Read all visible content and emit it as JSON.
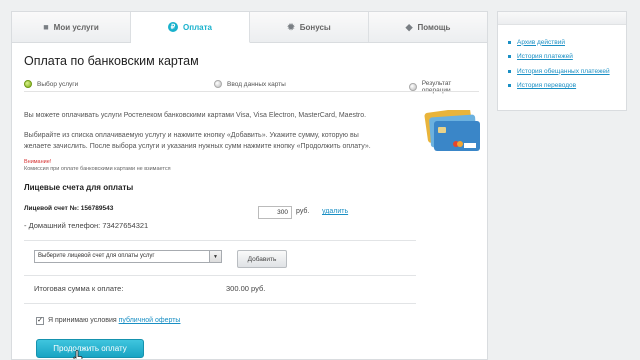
{
  "tabs": [
    {
      "label": "Мои услуги",
      "icon": "home-icon"
    },
    {
      "label": "Оплата",
      "icon": "payment-icon"
    },
    {
      "label": "Бонусы",
      "icon": "gear-icon"
    },
    {
      "label": "Помощь",
      "icon": "help-icon"
    }
  ],
  "page": {
    "title": "Оплата по банковским картам",
    "steps": [
      "Выбор услуги",
      "Ввод данных карты",
      "Результат операции"
    ],
    "desc1": "Вы можете оплачивать услуги Ростелеком банковскими картами Visa, Visa Electron, MasterCard, Maestro.",
    "desc2a": "Выбирайте из списка оплачиваемую услугу и нажмите кнопку «Добавить». Укажите сумму, которую вы",
    "desc2b": "желаете зачислить. После выбора услуги и указания нужных сумм нажмите кнопку «Продолжить оплату».",
    "warning": "Внимание!",
    "note": "Комиссия при оплате банковскими картами не взимается"
  },
  "accounts": {
    "section_title": "Лицевые счета для оплаты",
    "account_label": "Лицевой счет №: 156789543",
    "phone": "- Домашний телефон: 73427654321",
    "amount": "300",
    "currency": "руб.",
    "delete_link": "удалить",
    "select_placeholder": "Выберите лицевой счет для оплаты услуг",
    "add_button": "Добавить",
    "total_label": "Итоговая сумма к оплате:",
    "total_value": "300.00 руб.",
    "accept_text": "Я принимаю условия",
    "offer_link": "публичной оферты",
    "pay_button": "Продолжить оплату"
  },
  "sidebar": {
    "links": [
      "Архив действий",
      "История платежей",
      "История обещанных платежей",
      "История переводов"
    ]
  },
  "colors": {
    "accent": "#19b1cc",
    "link": "#1a8fc4",
    "warning": "#d63030"
  }
}
